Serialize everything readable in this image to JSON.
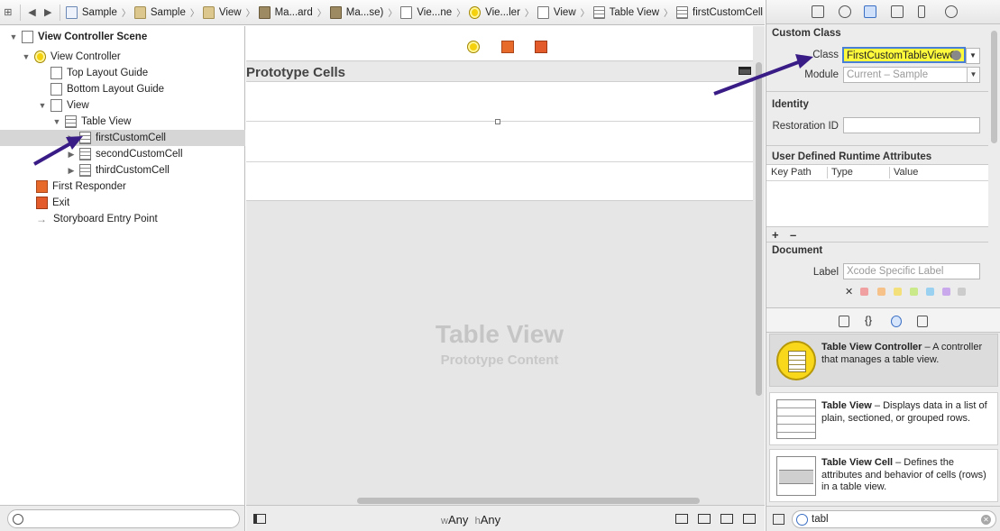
{
  "jumpbar": {
    "nav": [
      "back-icon",
      "forward-icon"
    ],
    "crumbs": [
      {
        "label": "Sample",
        "icon": "project-file-icon"
      },
      {
        "label": "Sample",
        "icon": "folder-icon"
      },
      {
        "label": "View",
        "icon": "folder-icon"
      },
      {
        "label": "Ma...ard",
        "icon": "storyboard-icon"
      },
      {
        "label": "Ma...se)",
        "icon": "storyboard-icon"
      },
      {
        "label": "Vie...ne",
        "icon": "scene-icon"
      },
      {
        "label": "Vie...ler",
        "icon": "view-controller-icon"
      },
      {
        "label": "View",
        "icon": "view-icon"
      },
      {
        "label": "Table View",
        "icon": "table-view-icon"
      },
      {
        "label": "firstCustomCell",
        "icon": "table-cell-icon"
      }
    ]
  },
  "outline": {
    "items": [
      {
        "label": "View Controller Scene",
        "bold": true
      },
      {
        "label": "View Controller"
      },
      {
        "label": "Top Layout Guide"
      },
      {
        "label": "Bottom Layout Guide"
      },
      {
        "label": "View"
      },
      {
        "label": "Table View"
      },
      {
        "label": "firstCustomCell",
        "selected": true
      },
      {
        "label": "secondCustomCell"
      },
      {
        "label": "thirdCustomCell"
      },
      {
        "label": "First Responder"
      },
      {
        "label": "Exit"
      },
      {
        "label": "Storyboard Entry Point"
      }
    ]
  },
  "canvas": {
    "prototype_header": "Prototype Cells",
    "table_title": "Table View",
    "table_subtitle": "Prototype Content",
    "size_class_w_prefix": "w",
    "size_class_w": "Any",
    "size_class_h_prefix": "h",
    "size_class_h": "Any"
  },
  "inspector": {
    "custom_class": {
      "title": "Custom Class",
      "class_label": "Class",
      "class_value": "FirstCustomTableViewC",
      "module_label": "Module",
      "module_placeholder": "Current – Sample"
    },
    "identity": {
      "title": "Identity",
      "restoration_label": "Restoration ID",
      "restoration_value": ""
    },
    "runtime": {
      "title": "User Defined Runtime Attributes",
      "columns": [
        "Key Path",
        "Type",
        "Value"
      ],
      "add": "+",
      "remove": "–"
    },
    "document": {
      "title": "Document",
      "label_label": "Label",
      "label_placeholder": "Xcode Specific Label",
      "clear": "✕",
      "swatches": [
        "#f0a0a0",
        "#f6c28a",
        "#f4e07a",
        "#c9e98a",
        "#9ad0f0",
        "#c9a8ec",
        "#cccccc"
      ]
    }
  },
  "library": {
    "items": [
      {
        "title": "Table View Controller",
        "desc": " – A controller that manages a table view.",
        "icon": "table-view-controller-icon",
        "selected": true
      },
      {
        "title": "Table View",
        "desc": " – Displays data in a list of plain, sectioned, or grouped rows.",
        "icon": "table-view-icon"
      },
      {
        "title": "Table View Cell",
        "desc": " – Defines the attributes and behavior of cells (rows) in a table view.",
        "icon": "table-view-cell-icon"
      }
    ],
    "filter_value": "tabl"
  },
  "colors": {
    "annotation_arrow": "#3a1c86",
    "highlight_field": "#fffb3c",
    "selection": "#d6d6d6"
  }
}
